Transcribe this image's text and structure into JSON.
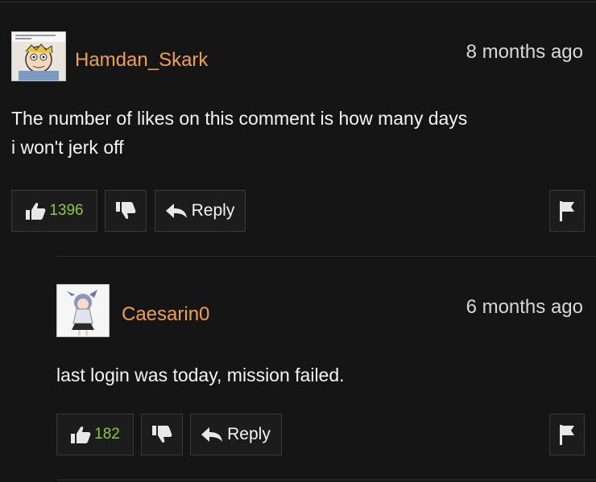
{
  "comments": [
    {
      "username": "Hamdan_Skark",
      "timestamp": "8 months ago",
      "text_line1": "The number of likes on this comment is how many days",
      "text_line2": "i won't jerk off",
      "likes": "1396",
      "reply_label": "Reply",
      "avatar_icon": "cartoon-avatar-icon"
    },
    {
      "username": "Caesarin0",
      "timestamp": "6 months ago",
      "text_line1": "last login was today, mission failed.",
      "likes": "182",
      "reply_label": "Reply",
      "avatar_icon": "anime-avatar-icon"
    }
  ],
  "colors": {
    "background": "#151515",
    "username": "#f0a048",
    "like_count": "#8fc63f",
    "border": "#3a3a3a"
  },
  "icons": [
    "thumbs-up-icon",
    "thumbs-down-icon",
    "reply-arrow-icon",
    "flag-icon"
  ]
}
